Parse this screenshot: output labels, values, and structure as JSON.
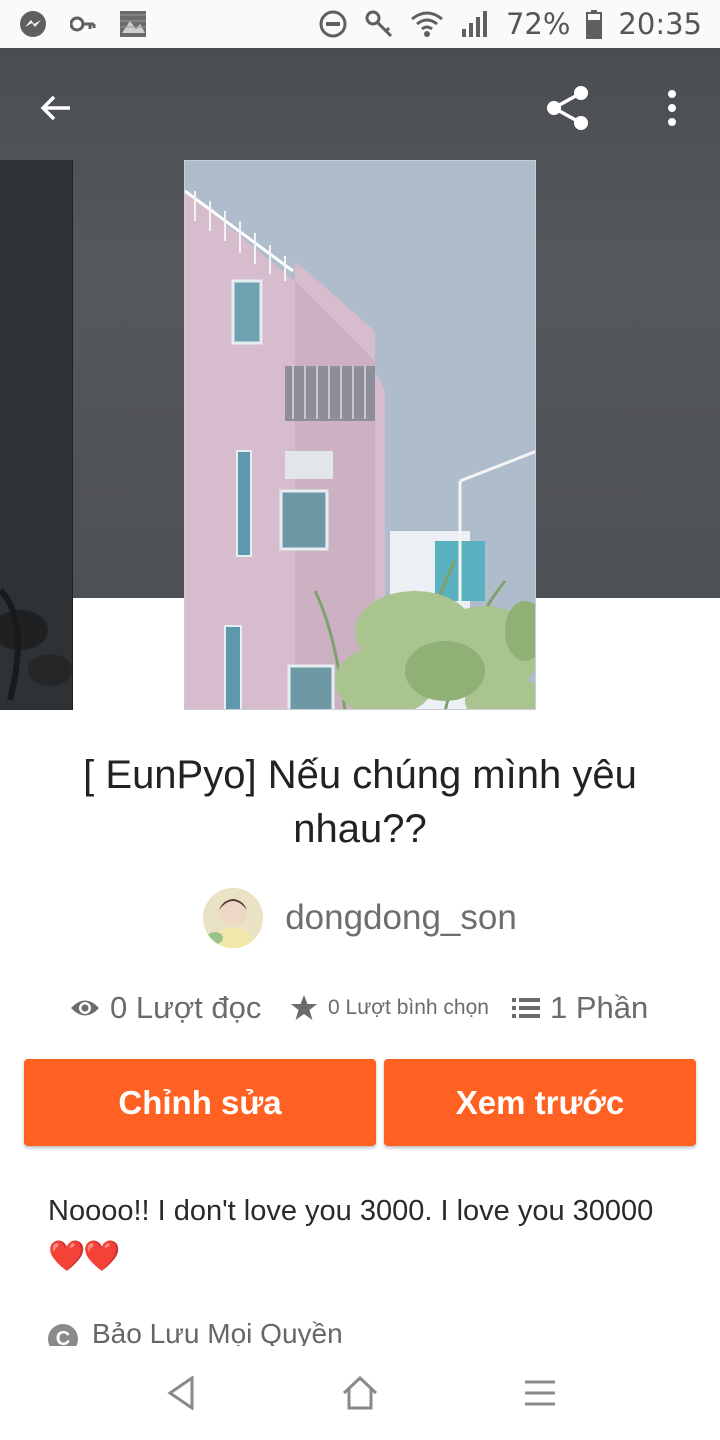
{
  "status_bar": {
    "battery": "72%",
    "time": "20:35",
    "left_icons": [
      "messenger-icon",
      "key-icon",
      "gallery-icon"
    ],
    "right_icons": [
      "do-not-disturb-icon",
      "key-icon",
      "wifi-icon",
      "signal-icon",
      "battery-icon"
    ]
  },
  "header": {
    "icons": [
      "back-arrow-icon",
      "share-icon",
      "more-vert-icon"
    ]
  },
  "story": {
    "title": "[ EunPyo] Nếu chúng mình yêu nhau??",
    "author": "dongdong_son",
    "stats": {
      "reads": "0 Lượt đọc",
      "votes": "0 Lượt bình chọn",
      "parts": "1 Phần"
    },
    "description": "Noooo!! I don't love you 3000. I love you 30000",
    "description_emoji": "❤️❤️",
    "copyright": "Bảo Lưu Mọi Quyền"
  },
  "actions": {
    "edit_label": "Chỉnh sửa",
    "preview_label": "Xem trước"
  },
  "colors": {
    "accent": "#ff6122",
    "header_bg": "#4f5256"
  },
  "nav_bar": {
    "icons": [
      "nav-back-icon",
      "nav-home-icon",
      "nav-menu-icon"
    ]
  }
}
